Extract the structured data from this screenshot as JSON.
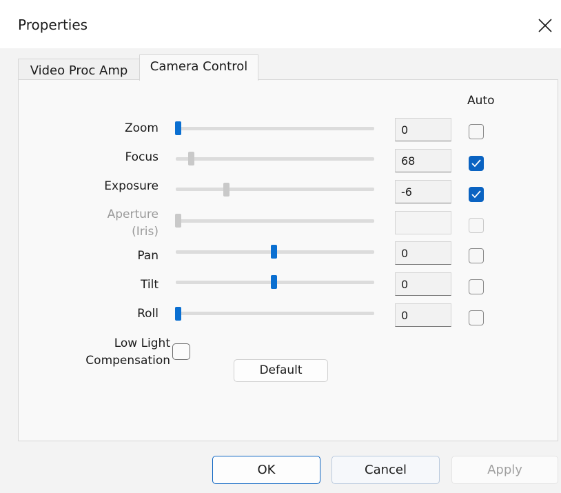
{
  "window": {
    "title": "Properties"
  },
  "tabs": [
    {
      "label": "Video Proc Amp",
      "active": false
    },
    {
      "label": "Camera Control",
      "active": true
    }
  ],
  "columns": {
    "auto_label": "Auto"
  },
  "controls": [
    {
      "label": "Zoom",
      "value": "0",
      "slider_position": 0.0,
      "auto": false,
      "enabled": true
    },
    {
      "label": "Focus",
      "value": "68",
      "slider_position": 0.08,
      "auto": true,
      "enabled": false
    },
    {
      "label": "Exposure",
      "value": "-6",
      "slider_position": 0.26,
      "auto": true,
      "enabled": false
    },
    {
      "label_line1": "Aperture",
      "label_line2": "(Iris)",
      "value": "",
      "slider_position": 0.0,
      "auto": false,
      "enabled": false,
      "disabled": true
    },
    {
      "label": "Pan",
      "value": "0",
      "slider_position": 0.5,
      "auto": false,
      "enabled": true
    },
    {
      "label": "Tilt",
      "value": "0",
      "slider_position": 0.5,
      "auto": false,
      "enabled": true
    },
    {
      "label": "Roll",
      "value": "0",
      "slider_position": 0.0,
      "auto": false,
      "enabled": true
    }
  ],
  "low_light": {
    "line1": "Low Light",
    "line2": "Compensation",
    "checked": false
  },
  "buttons": {
    "default": "Default",
    "ok": "OK",
    "cancel": "Cancel",
    "apply": "Apply"
  },
  "colors": {
    "accent": "#0a63c2",
    "slider_active": "#0a6fd1",
    "slider_inactive": "#c9c9c9",
    "disabled_text": "#9a9a9a"
  }
}
